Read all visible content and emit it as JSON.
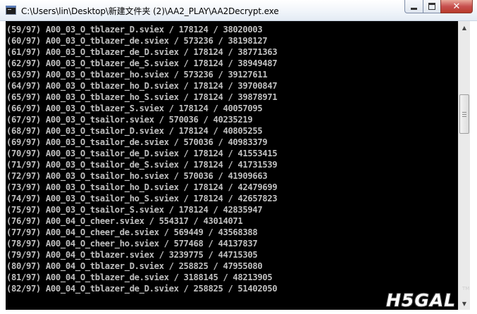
{
  "window": {
    "title": "C:\\Users\\lin\\Desktop\\新建文件夹 (2)\\AA2_PLAY\\AA2Decrypt.exe",
    "close_label": "✕"
  },
  "console": {
    "lines": [
      "(59/97) A00_03_O_tblazer_D.sviex / 178124 / 38020003",
      "(60/97) A00_03_O_tblazer_de.sviex / 573236 / 38198127",
      "(61/97) A00_03_O_tblazer_de_D.sviex / 178124 / 38771363",
      "(62/97) A00_03_O_tblazer_de_S.sviex / 178124 / 38949487",
      "(63/97) A00_03_O_tblazer_ho.sviex / 573236 / 39127611",
      "(64/97) A00_03_O_tblazer_ho_D.sviex / 178124 / 39700847",
      "(65/97) A00_03_O_tblazer_ho_S.sviex / 178124 / 39878971",
      "(66/97) A00_03_O_tblazer_S.sviex / 178124 / 40057095",
      "(67/97) A00_03_O_tsailor.sviex / 570036 / 40235219",
      "(68/97) A00_03_O_tsailor_D.sviex / 178124 / 40805255",
      "(69/97) A00_03_O_tsailor_de.sviex / 570036 / 40983379",
      "(70/97) A00_03_O_tsailor_de_D.sviex / 178124 / 41553415",
      "(71/97) A00_03_O_tsailor_de_S.sviex / 178124 / 41731539",
      "(72/97) A00_03_O_tsailor_ho.sviex / 570036 / 41909663",
      "(73/97) A00_03_O_tsailor_ho_D.sviex / 178124 / 42479699",
      "(74/97) A00_03_O_tsailor_ho_S.sviex / 178124 / 42657823",
      "(75/97) A00_03_O_tsailor_S.sviex / 178124 / 42835947",
      "(76/97) A00_04_O_cheer.sviex / 554317 / 43014071",
      "(77/97) A00_04_O_cheer_de.sviex / 569449 / 43568388",
      "(78/97) A00_04_O_cheer_ho.sviex / 577468 / 44137837",
      "(79/97) A00_04_O_tblazer.sviex / 3239775 / 44715305",
      "(80/97) A00_04_O_tblazer_D.sviex / 258825 / 47955080",
      "(81/97) A00_04_O_tblazer_de.sviex / 3188145 / 48213905",
      "(82/97) A00_04_O_tblazer_de_D.sviex / 258825 / 51402050"
    ],
    "text_color": "#c0c0c0",
    "background_color": "#000000"
  },
  "scrollbar": {
    "up_arrow": "▲",
    "down_arrow": "▼"
  },
  "watermark": {
    "text": "H5GAL",
    "trademark": "TM"
  }
}
